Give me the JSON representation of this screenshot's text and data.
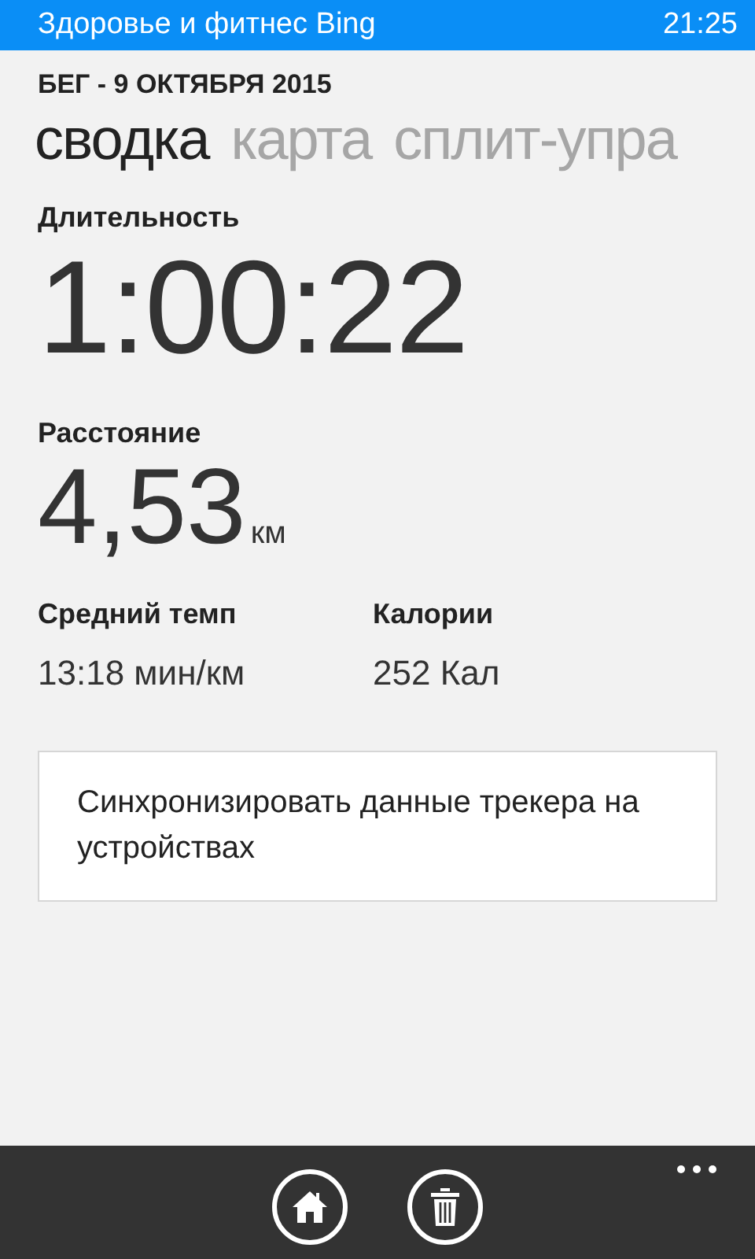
{
  "status_bar": {
    "app_name": "Здоровье и фитнес Bing",
    "time": "21:25"
  },
  "header": {
    "title": "БЕГ - 9 ОКТЯБРЯ 2015"
  },
  "tabs": [
    {
      "label": "сводка",
      "selected": true
    },
    {
      "label": "карта",
      "selected": false
    },
    {
      "label": "сплит-упра",
      "selected": false
    }
  ],
  "duration": {
    "label": "Длительность",
    "value": "1:00:22"
  },
  "distance": {
    "label": "Расстояние",
    "value": "4,53",
    "unit": "км"
  },
  "metrics": [
    {
      "label": "Средний темп",
      "value": "13:18 мин/км"
    },
    {
      "label": "Калории",
      "value": "252 Кал"
    }
  ],
  "sync_button": {
    "label": "Синхронизировать данные трекера на устройствах"
  },
  "app_bar": {
    "buttons": [
      {
        "kind": "home"
      },
      {
        "kind": "delete"
      }
    ]
  }
}
